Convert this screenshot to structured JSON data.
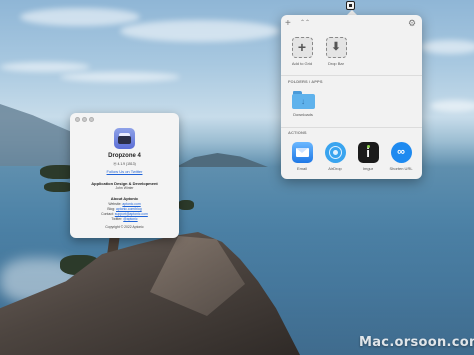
{
  "about_window": {
    "app_name": "Dropzone 4",
    "version": "⦿ 4.1.9 (1513)",
    "follow_link": "Follow Us on Twitter",
    "design_heading": "Application Design & Development",
    "developer": "John Winter",
    "about_heading": "About Aptonic",
    "website_label": "Website:",
    "website_value": "aptonic.com",
    "blog_label": "Blog:",
    "blog_value": "aptonic.com/blog",
    "contact_label": "Contact:",
    "contact_value": "support@aptonic.com",
    "twitter_label": "Twitter:",
    "twitter_value": "@aptonic",
    "copyright": "Copyright © 2022 Aptonic"
  },
  "dropzone_panel": {
    "toolbar": {
      "add_icon": "plus-icon",
      "collapse_icon": "chevron-up-icon",
      "settings_icon": "gear-icon"
    },
    "tools": [
      {
        "label": "Add to Grid",
        "icon": "plus-icon"
      },
      {
        "label": "Drop Bar",
        "icon": "download-arrow-icon"
      }
    ],
    "folders_heading": "FOLDERS / APPS",
    "folders": [
      {
        "label": "Downloads",
        "icon": "downloads-folder-icon"
      }
    ],
    "actions_heading": "ACTIONS",
    "actions": [
      {
        "label": "Email",
        "icon": "mail-icon"
      },
      {
        "label": "AirDrop",
        "icon": "airdrop-icon"
      },
      {
        "label": "Imgur",
        "icon": "imgur-icon"
      },
      {
        "label": "Shorten URL",
        "icon": "link-icon"
      }
    ]
  },
  "watermark": "Mac.orsoon.com",
  "colors": {
    "panel_bg": "#f2f2f2",
    "link": "#1f63d8",
    "accent_blue": "#1e8af0"
  }
}
